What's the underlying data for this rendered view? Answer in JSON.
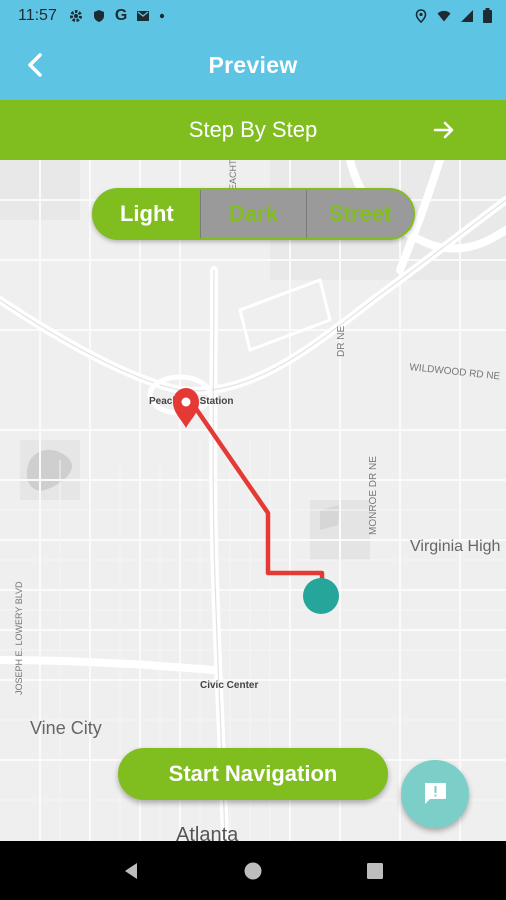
{
  "status_bar": {
    "time": "11:57",
    "left_icons": [
      "gear-icon",
      "shield-icon",
      "google-g-icon",
      "mail-icon",
      "dot-icon"
    ],
    "right_icons": [
      "location-icon",
      "wifi-icon",
      "signal-icon",
      "battery-icon"
    ]
  },
  "header": {
    "title": "Preview",
    "back_icon": "chevron-left-icon"
  },
  "step_bar": {
    "label": "Step By Step",
    "arrow_icon": "arrow-right-icon"
  },
  "map_style": {
    "options": [
      "Light",
      "Dark",
      "Street"
    ],
    "selected": "Light"
  },
  "map": {
    "labels": {
      "peachtree_station": "Peachtree Station",
      "civic_center": "Civic Center",
      "virginia_highland": "Virginia High",
      "vine_city": "Vine City",
      "atlanta": "Atlanta",
      "wildwood": "WILDWOOD RD NE",
      "monroe": "MONROE DR NE",
      "lowery": "JOSEPH E. LOWERY BLVD",
      "piedmont": "DR NE",
      "peachtree_n": "PEACHTREE"
    },
    "route_color": "#e53935",
    "pin_color": "#e53935",
    "current_location_color": "#26a69a"
  },
  "start_button": {
    "label": "Start Navigation"
  },
  "feedback_button": {
    "icon": "feedback-icon"
  },
  "nav_bar": {
    "back_icon": "nav-back-icon",
    "home_icon": "nav-home-icon",
    "recents_icon": "nav-recents-icon"
  },
  "colors": {
    "header": "#5ec4e4",
    "accent_green": "#80be1f",
    "fab": "#7ccfc9"
  }
}
